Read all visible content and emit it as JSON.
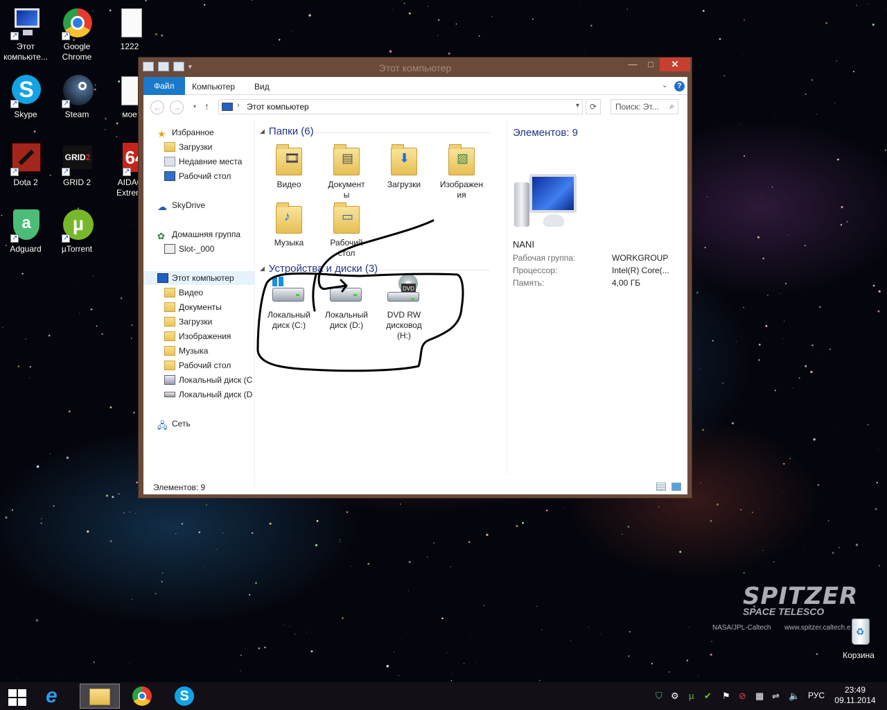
{
  "desktop_icons": [
    {
      "label": "Этот компьюте...",
      "icon": "computer-icon"
    },
    {
      "label": "Google Chrome",
      "icon": "chrome-icon"
    },
    {
      "label": "1222",
      "icon": "text-file-icon"
    },
    {
      "label": "Skype",
      "icon": "skype-icon"
    },
    {
      "label": "Steam",
      "icon": "steam-icon"
    },
    {
      "label": "мое",
      "icon": "text-file-icon"
    },
    {
      "label": "Dota 2",
      "icon": "dota2-icon"
    },
    {
      "label": "GRID 2",
      "icon": "grid2-icon"
    },
    {
      "label": "AIDA6 Extrem",
      "icon": "aida64-icon"
    },
    {
      "label": "Adguard",
      "icon": "adguard-icon"
    },
    {
      "label": "µTorrent",
      "icon": "utorrent-icon"
    },
    {
      "label": "Корзина",
      "icon": "recycle-bin-icon"
    }
  ],
  "window": {
    "title": "Этот компьютер",
    "controls": {
      "minimize": "—",
      "maximize": "□",
      "close": "✕"
    }
  },
  "ribbon": {
    "tabs": [
      "Файл",
      "Компьютер",
      "Вид"
    ],
    "help": "?"
  },
  "address_bar": {
    "path": "Этот компьютер",
    "search_placeholder": "Поиск: Эт..."
  },
  "nav_pane": {
    "favorites": "Избранное",
    "favorites_items": [
      "Загрузки",
      "Недавние места",
      "Рабочий стол"
    ],
    "skydrive": "SkyDrive",
    "homegroup": "Домашняя группа",
    "homegroup_items": [
      "Slot-_000"
    ],
    "this_pc": "Этот компьютер",
    "this_pc_items": [
      "Видео",
      "Документы",
      "Загрузки",
      "Изображения",
      "Музыка",
      "Рабочий стол",
      "Локальный диск (C",
      "Локальный диск (D"
    ],
    "network": "Сеть"
  },
  "content": {
    "folders_header": "Папки (6)",
    "folders": [
      {
        "label": "Видео",
        "icon": "video-folder-icon"
      },
      {
        "label": "Документы",
        "icon": "documents-folder-icon"
      },
      {
        "label": "Загрузки",
        "icon": "downloads-folder-icon"
      },
      {
        "label": "Изображения",
        "icon": "pictures-folder-icon"
      },
      {
        "label": "Музыка",
        "icon": "music-folder-icon"
      },
      {
        "label": "Рабочий стол",
        "icon": "desktop-folder-icon"
      }
    ],
    "devices_header": "Устройства и диски (3)",
    "devices": [
      {
        "label": "Локальный диск (C:)",
        "icon": "system-drive-icon"
      },
      {
        "label": "Локальный диск (D:)",
        "icon": "hard-drive-icon"
      },
      {
        "label": "DVD RW дисковод (H:)",
        "icon": "dvd-drive-icon"
      }
    ]
  },
  "details": {
    "count": "Элементов: 9",
    "name": "NANI",
    "rows": [
      {
        "key": "Рабочая группа:",
        "value": "WORKGROUP"
      },
      {
        "key": "Процессор:",
        "value": "Intel(R) Core(..."
      },
      {
        "key": "Память:",
        "value": "4,00 ГБ"
      }
    ]
  },
  "status_bar": {
    "text": "Элементов: 9"
  },
  "wallpaper": {
    "title": "SPITZER",
    "subtitle": "SPACE TELESCO",
    "credit_left": "NASA/JPL-Caltech",
    "credit_right": "www.spitzer.caltech.e"
  },
  "taskbar": {
    "apps": [
      "windows-start-icon",
      "internet-explorer-icon",
      "file-explorer-icon",
      "chrome-icon",
      "skype-icon"
    ],
    "language": "РУС",
    "time": "23:49",
    "date": "09.11.2014"
  },
  "colors": {
    "accent": "#1979ca",
    "window_frame": "#6b4a3a",
    "close": "#c7402f",
    "header_text": "#1e3287"
  }
}
